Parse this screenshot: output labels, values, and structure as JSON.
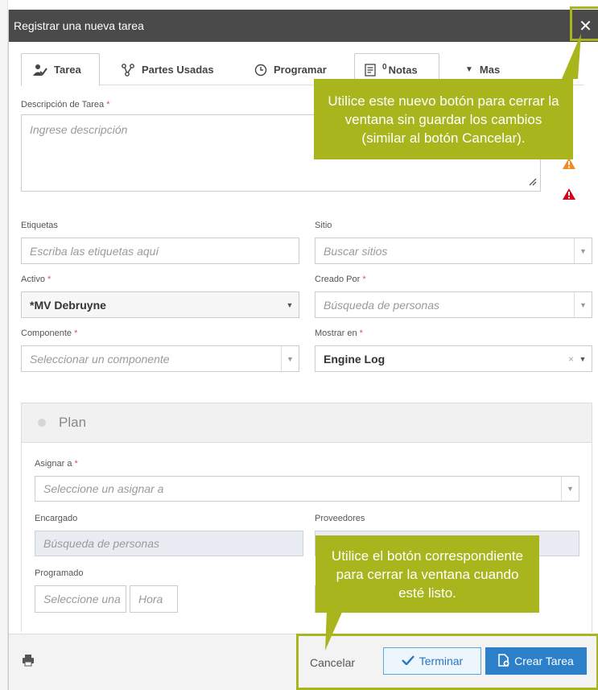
{
  "dialog": {
    "title": "Registrar una nueva tarea",
    "close_symbol": "✕"
  },
  "tabs": [
    {
      "label": "Tarea",
      "icon": "task-icon"
    },
    {
      "label": "Partes Usadas",
      "icon": "parts-icon"
    },
    {
      "label": "Programar",
      "icon": "clock-icon"
    },
    {
      "label": "Notas",
      "count": "0",
      "icon": "notes-icon"
    },
    {
      "label": "Mas",
      "icon": "caret-down-icon"
    }
  ],
  "form": {
    "description": {
      "label": "Descripción de Tarea",
      "placeholder": "Ingrese descripción"
    },
    "tags": {
      "label": "Etiquetas",
      "placeholder": "Escriba las etiquetas aquí"
    },
    "site": {
      "label": "Sitio",
      "placeholder": "Buscar sitios"
    },
    "asset": {
      "label": "Activo",
      "value": "*MV Debruyne"
    },
    "created_by": {
      "label": "Creado Por",
      "placeholder": "Búsqueda de personas"
    },
    "component": {
      "label": "Componente",
      "placeholder": "Seleccionar un componente"
    },
    "show_in": {
      "label": "Mostrar en",
      "value": "Engine Log"
    }
  },
  "plan": {
    "title": "Plan",
    "assign_to": {
      "label": "Asignar a",
      "placeholder": "Seleccione un asignar a"
    },
    "manager": {
      "label": "Encargado",
      "placeholder": "Búsqueda de personas"
    },
    "suppliers": {
      "label": "Proveedores"
    },
    "scheduled": {
      "label": "Programado",
      "date_placeholder": "Seleccione una",
      "time_placeholder": "Hora"
    }
  },
  "footer": {
    "cancel_label": "Cancelar",
    "finish_label": "Terminar",
    "create_label": "Crear Tarea"
  },
  "callouts": {
    "close": "Utilice este nuevo botón para cerrar la ventana sin guardar los cambios (similar al botón Cancelar).",
    "cancel": "Utilice el botón correspondiente para cerrar la ventana cuando esté listo."
  },
  "colors": {
    "titlebar": "#4a4a4a",
    "callout": "#a8b51c",
    "primary": "#2c7fc9",
    "required": "#d9534f",
    "warning_orange": "#f08a24",
    "warning_red": "#d0021b"
  }
}
